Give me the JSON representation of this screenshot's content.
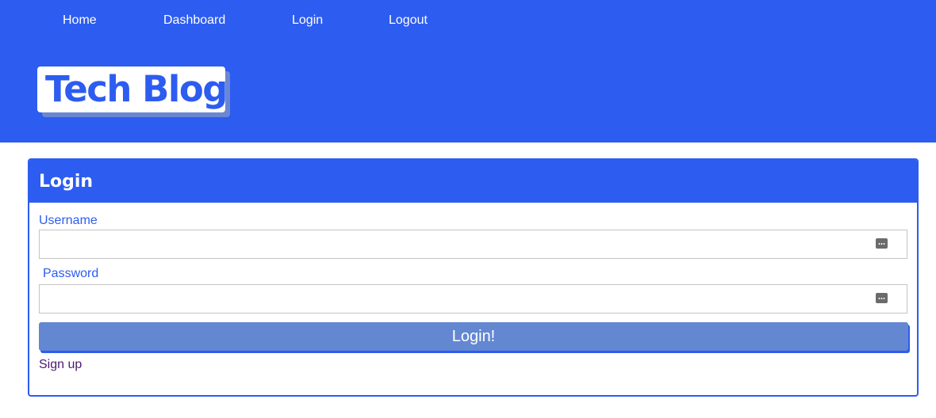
{
  "nav": {
    "items": [
      {
        "label": "Home"
      },
      {
        "label": "Dashboard"
      },
      {
        "label": "Login"
      },
      {
        "label": "Logout"
      }
    ]
  },
  "brand": {
    "title": "Tech Blog"
  },
  "login_card": {
    "title": "Login",
    "username_label": "Username",
    "username_value": "",
    "password_label": "Password",
    "password_value": "",
    "submit_label": "Login!",
    "signup_label": "Sign up"
  },
  "colors": {
    "primary": "#2d5cf0",
    "button": "#6487d2",
    "link_visited": "#4b1a6f"
  },
  "icons": {
    "field_autofill": "password-manager-key-icon"
  }
}
